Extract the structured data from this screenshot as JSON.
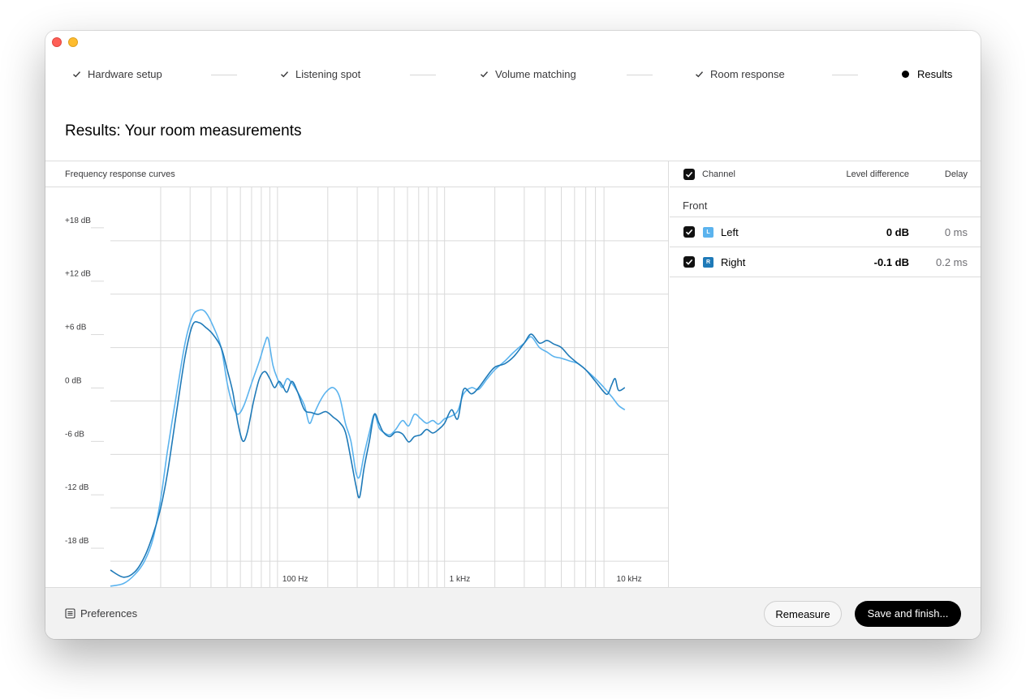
{
  "window": {
    "title_bar_controls": [
      "close",
      "minimize"
    ]
  },
  "steps": [
    {
      "label": "Hardware setup",
      "state": "done",
      "icon": "check-icon"
    },
    {
      "label": "Listening spot",
      "state": "done",
      "icon": "check-icon"
    },
    {
      "label": "Volume matching",
      "state": "done",
      "icon": "check-icon"
    },
    {
      "label": "Room response",
      "state": "done",
      "icon": "check-icon"
    },
    {
      "label": "Results",
      "state": "current",
      "icon": "dot-icon"
    }
  ],
  "page_title": "Results: Your room measurements",
  "chart_panel": {
    "title": "Frequency response curves"
  },
  "table": {
    "header": {
      "channel": "Channel",
      "level": "Level difference",
      "delay": "Delay",
      "select_all_checked": true
    },
    "group": "Front",
    "rows": [
      {
        "badge": "L",
        "name": "Left",
        "level": "0 dB",
        "delay": "0 ms",
        "checked": true,
        "color": "#5bb3ee"
      },
      {
        "badge": "R",
        "name": "Right",
        "level": "-0.1 dB",
        "delay": "0.2 ms",
        "checked": true,
        "color": "#1f7ab8"
      }
    ]
  },
  "footer": {
    "preferences": "Preferences",
    "remeasure": "Remeasure",
    "save": "Save and finish..."
  },
  "chart_data": {
    "type": "line",
    "title": "Frequency response curves",
    "x_scale": "log",
    "xlim": [
      10,
      22000
    ],
    "ylim": [
      -21,
      24
    ],
    "x_tick_labels": [
      {
        "value": 100,
        "label": "100 Hz"
      },
      {
        "value": 1000,
        "label": "1 kHz"
      },
      {
        "value": 10000,
        "label": "10 kHz"
      }
    ],
    "y_tick_labels": [
      {
        "value": 18,
        "label": "+18 dB"
      },
      {
        "value": 12,
        "label": "+12 dB"
      },
      {
        "value": 6,
        "label": "+6 dB"
      },
      {
        "value": 0,
        "label": "0 dB"
      },
      {
        "value": -6,
        "label": "-6 dB"
      },
      {
        "value": -12,
        "label": "-12 dB"
      },
      {
        "value": -18,
        "label": "-18 dB"
      }
    ],
    "grid": true,
    "series": [
      {
        "name": "Left",
        "color": "#5bb3ee",
        "points": [
          [
            10,
            -20.8
          ],
          [
            12,
            -20.5
          ],
          [
            14,
            -19.5
          ],
          [
            16,
            -18
          ],
          [
            18,
            -15.5
          ],
          [
            20,
            -11
          ],
          [
            22,
            -5.5
          ],
          [
            25,
            1
          ],
          [
            28,
            6.5
          ],
          [
            31,
            9.5
          ],
          [
            34,
            10.2
          ],
          [
            37,
            10
          ],
          [
            41,
            8.5
          ],
          [
            46,
            6
          ],
          [
            50,
            2
          ],
          [
            54,
            -0.5
          ],
          [
            58,
            -1.5
          ],
          [
            63,
            -0.5
          ],
          [
            70,
            2
          ],
          [
            78,
            4.5
          ],
          [
            84,
            6.5
          ],
          [
            88,
            7
          ],
          [
            94,
            4
          ],
          [
            100,
            2.5
          ],
          [
            107,
            1.5
          ],
          [
            114,
            2.5
          ],
          [
            122,
            2
          ],
          [
            132,
            1
          ],
          [
            145,
            -0.5
          ],
          [
            155,
            -2.5
          ],
          [
            165,
            -1.5
          ],
          [
            180,
            0
          ],
          [
            195,
            1
          ],
          [
            215,
            1.5
          ],
          [
            235,
            0.5
          ],
          [
            255,
            -2.5
          ],
          [
            275,
            -4.5
          ],
          [
            295,
            -8
          ],
          [
            310,
            -8.5
          ],
          [
            330,
            -6
          ],
          [
            355,
            -3.5
          ],
          [
            380,
            -1.5
          ],
          [
            405,
            -3
          ],
          [
            430,
            -3.5
          ],
          [
            470,
            -3.8
          ],
          [
            510,
            -3.2
          ],
          [
            560,
            -2.2
          ],
          [
            610,
            -2.8
          ],
          [
            660,
            -1.5
          ],
          [
            720,
            -2
          ],
          [
            780,
            -2.5
          ],
          [
            850,
            -2.2
          ],
          [
            920,
            -2.6
          ],
          [
            1000,
            -2
          ],
          [
            1100,
            -1.7
          ],
          [
            1200,
            -1.1
          ],
          [
            1300,
            0.8
          ],
          [
            1450,
            1.5
          ],
          [
            1600,
            1.3
          ],
          [
            1800,
            2.5
          ],
          [
            2000,
            3.5
          ],
          [
            2300,
            4.5
          ],
          [
            2600,
            5.5
          ],
          [
            3000,
            6.5
          ],
          [
            3300,
            7.2
          ],
          [
            3700,
            6
          ],
          [
            4100,
            5.5
          ],
          [
            4500,
            5
          ],
          [
            5000,
            4.8
          ],
          [
            5600,
            4.5
          ],
          [
            6300,
            4.2
          ],
          [
            7000,
            3.5
          ],
          [
            8000,
            2.5
          ],
          [
            9000,
            1.5
          ],
          [
            10000,
            0.5
          ],
          [
            11000,
            -0.5
          ],
          [
            12000,
            -1
          ]
        ]
      },
      {
        "name": "Right",
        "color": "#1f7ab8",
        "points": [
          [
            10,
            -19
          ],
          [
            12,
            -19.8
          ],
          [
            14,
            -19.2
          ],
          [
            16,
            -17.5
          ],
          [
            18,
            -15
          ],
          [
            20,
            -12
          ],
          [
            22,
            -8
          ],
          [
            25,
            -1
          ],
          [
            28,
            5
          ],
          [
            31,
            8.5
          ],
          [
            34,
            8.8
          ],
          [
            37,
            8.3
          ],
          [
            41,
            7.5
          ],
          [
            46,
            6
          ],
          [
            50,
            3.5
          ],
          [
            54,
            1
          ],
          [
            58,
            -2.5
          ],
          [
            62,
            -4.5
          ],
          [
            66,
            -3.5
          ],
          [
            72,
            0
          ],
          [
            78,
            2.5
          ],
          [
            84,
            3.3
          ],
          [
            90,
            2.5
          ],
          [
            96,
            1.5
          ],
          [
            102,
            2.2
          ],
          [
            108,
            1.6
          ],
          [
            114,
            1
          ],
          [
            122,
            2.2
          ],
          [
            132,
            1
          ],
          [
            145,
            -1
          ],
          [
            160,
            -1.3
          ],
          [
            175,
            -1.5
          ],
          [
            195,
            -1.2
          ],
          [
            215,
            -1.8
          ],
          [
            235,
            -2.4
          ],
          [
            255,
            -3.5
          ],
          [
            275,
            -6.5
          ],
          [
            295,
            -9.5
          ],
          [
            310,
            -10.8
          ],
          [
            330,
            -7.5
          ],
          [
            355,
            -4.5
          ],
          [
            380,
            -1.5
          ],
          [
            405,
            -2.5
          ],
          [
            430,
            -3.5
          ],
          [
            470,
            -4
          ],
          [
            510,
            -3.5
          ],
          [
            560,
            -3.7
          ],
          [
            610,
            -4.6
          ],
          [
            660,
            -4
          ],
          [
            720,
            -3.8
          ],
          [
            780,
            -3.2
          ],
          [
            850,
            -3.6
          ],
          [
            920,
            -3.2
          ],
          [
            1000,
            -2.5
          ],
          [
            1100,
            -1
          ],
          [
            1200,
            -2
          ],
          [
            1300,
            1.3
          ],
          [
            1450,
            0.8
          ],
          [
            1600,
            1.5
          ],
          [
            1800,
            2.8
          ],
          [
            2000,
            3.8
          ],
          [
            2300,
            4.2
          ],
          [
            2600,
            5
          ],
          [
            3000,
            6.5
          ],
          [
            3300,
            7.5
          ],
          [
            3700,
            6.5
          ],
          [
            4100,
            6.8
          ],
          [
            4500,
            6.4
          ],
          [
            5000,
            6
          ],
          [
            5600,
            5
          ],
          [
            6300,
            4.2
          ],
          [
            7000,
            3.5
          ],
          [
            8000,
            2.2
          ],
          [
            9000,
            1
          ],
          [
            9500,
            0.8
          ],
          [
            10000,
            1.8
          ],
          [
            10500,
            2.5
          ],
          [
            11000,
            1.2
          ],
          [
            12000,
            1.5
          ]
        ]
      }
    ]
  }
}
